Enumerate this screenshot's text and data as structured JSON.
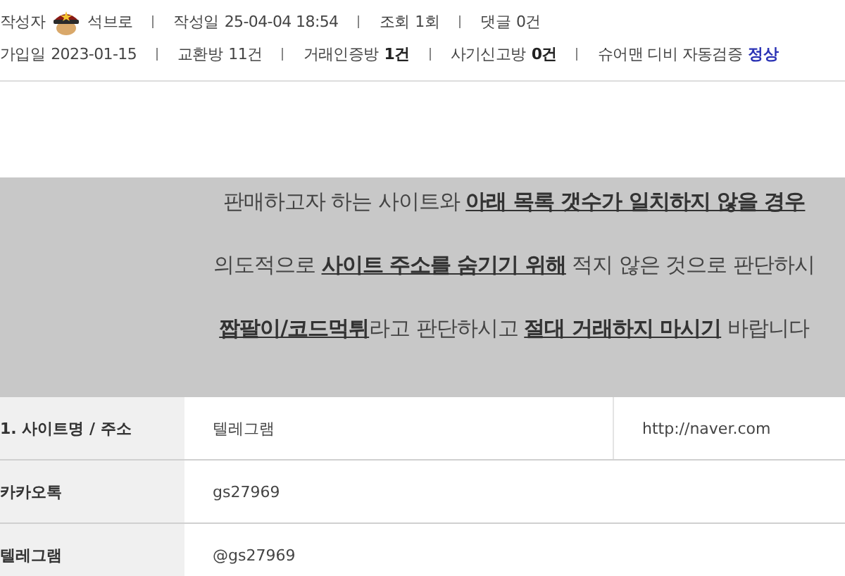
{
  "meta_rows": [
    {
      "items": [
        {
          "kind": "author",
          "label": "작성자",
          "value": "석브로"
        },
        {
          "kind": "plain",
          "label": "작성일",
          "value": "25-04-04 18:54"
        },
        {
          "kind": "plain",
          "label": "조회",
          "value": "1회"
        },
        {
          "kind": "plain",
          "label": "댓글",
          "value": "0건"
        }
      ]
    },
    {
      "items": [
        {
          "kind": "plain",
          "label": "가입일",
          "value": "2023-01-15"
        },
        {
          "kind": "plain",
          "label": "교환방",
          "value": "11건"
        },
        {
          "kind": "count",
          "label": "거래인증방",
          "value": "1건"
        },
        {
          "kind": "count",
          "label": "사기신고방",
          "value": "0건"
        },
        {
          "kind": "status",
          "label": "슈어맨 디비 자동검증",
          "value": "정상"
        }
      ]
    }
  ],
  "notice": [
    "판매하고자 하는 사이트와 **아래 목록 갯수가 일치하지 않을 경우**",
    "의도적으로 **사이트 주소를 숨기기 위해** 적지 않은 것으로 판단하시",
    "**짭팔이/코드먹튀**라고 판단하시고 **절대 거래하지 마시기** 바랍니다"
  ],
  "table": {
    "rows": [
      {
        "label": "1. 사이트명 / 주소",
        "cells": [
          {
            "text": "텔레그램"
          },
          {
            "text": "http://naver.com"
          }
        ]
      },
      {
        "label": "카카오톡",
        "cells": [
          {
            "text": "gs27969",
            "colspan": 2
          }
        ]
      },
      {
        "label": "텔레그램",
        "cells": [
          {
            "text": "@gs27969",
            "colspan": 2
          }
        ]
      }
    ]
  }
}
